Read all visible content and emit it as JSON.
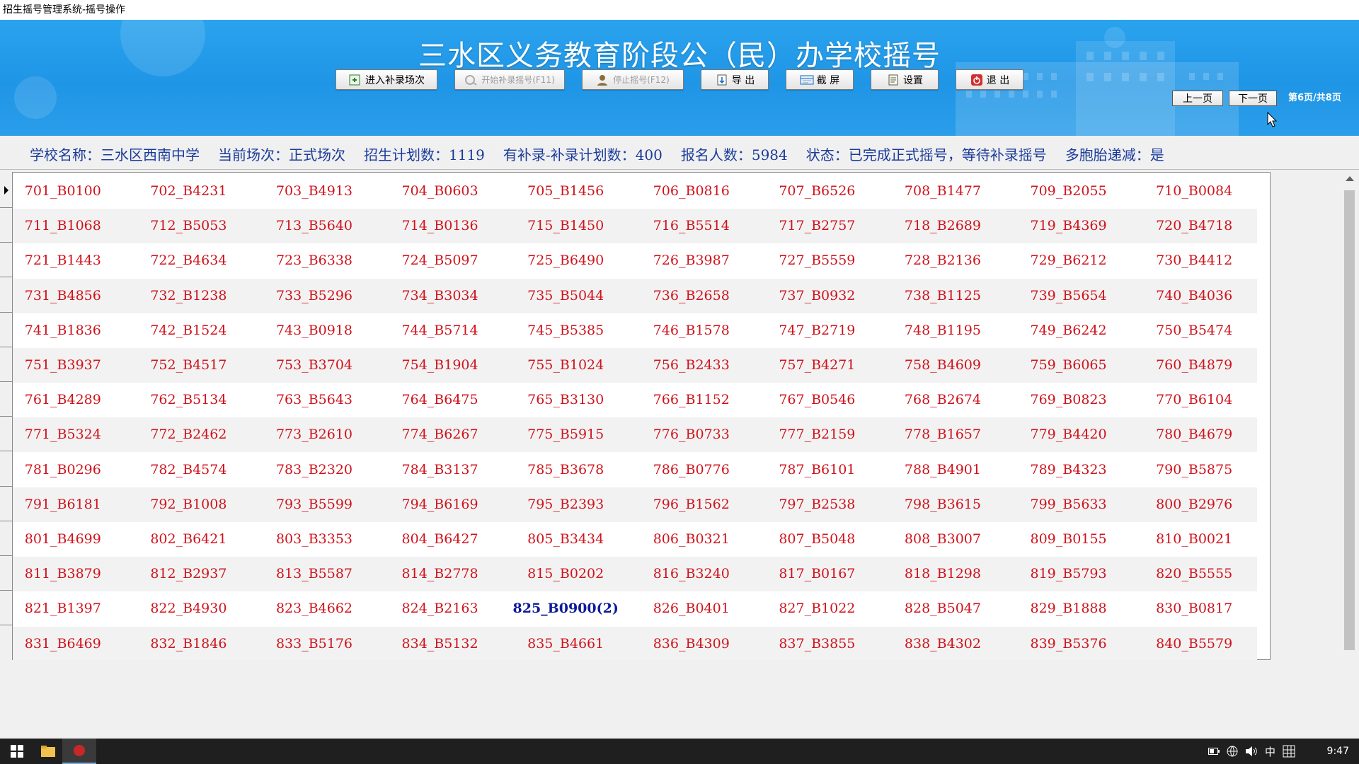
{
  "window": {
    "title": "招生摇号管理系统-摇号操作"
  },
  "banner": {
    "title": "三水区义务教育阶段公（民）办学校摇号"
  },
  "toolbar": {
    "enter_supplement": "进入补录场次",
    "start_supplement": "开始补录摇号(F11)",
    "stop_lottery": "停止摇号(F12)",
    "export": "导 出",
    "screenshot": "截 屏",
    "settings": "设置",
    "exit": "退 出"
  },
  "pager": {
    "prev": "上一页",
    "next": "下一页",
    "page_info": "第6页/共8页"
  },
  "info": {
    "school": "学校名称：三水区西南中学",
    "session": "当前场次：正式场次",
    "plan": "招生计划数：1119",
    "supplement_plan": "有补录-补录计划数：400",
    "applicants": "报名人数：5984",
    "status": "状态：已完成正式摇号，等待补录摇号",
    "multi_birth": "多胞胎递减：是"
  },
  "grid": {
    "rows": [
      [
        "701_B0100",
        "702_B4231",
        "703_B4913",
        "704_B0603",
        "705_B1456",
        "706_B0816",
        "707_B6526",
        "708_B1477",
        "709_B2055",
        "710_B0084"
      ],
      [
        "711_B1068",
        "712_B5053",
        "713_B5640",
        "714_B0136",
        "715_B1450",
        "716_B5514",
        "717_B2757",
        "718_B2689",
        "719_B4369",
        "720_B4718"
      ],
      [
        "721_B1443",
        "722_B4634",
        "723_B6338",
        "724_B5097",
        "725_B6490",
        "726_B3987",
        "727_B5559",
        "728_B2136",
        "729_B6212",
        "730_B4412"
      ],
      [
        "731_B4856",
        "732_B1238",
        "733_B5296",
        "734_B3034",
        "735_B5044",
        "736_B2658",
        "737_B0932",
        "738_B1125",
        "739_B5654",
        "740_B4036"
      ],
      [
        "741_B1836",
        "742_B1524",
        "743_B0918",
        "744_B5714",
        "745_B5385",
        "746_B1578",
        "747_B2719",
        "748_B1195",
        "749_B6242",
        "750_B5474"
      ],
      [
        "751_B3937",
        "752_B4517",
        "753_B3704",
        "754_B1904",
        "755_B1024",
        "756_B2433",
        "757_B4271",
        "758_B4609",
        "759_B6065",
        "760_B4879"
      ],
      [
        "761_B4289",
        "762_B5134",
        "763_B5643",
        "764_B6475",
        "765_B3130",
        "766_B1152",
        "767_B0546",
        "768_B2674",
        "769_B0823",
        "770_B6104"
      ],
      [
        "771_B5324",
        "772_B2462",
        "773_B2610",
        "774_B6267",
        "775_B5915",
        "776_B0733",
        "777_B2159",
        "778_B1657",
        "779_B4420",
        "780_B4679"
      ],
      [
        "781_B0296",
        "782_B4574",
        "783_B2320",
        "784_B3137",
        "785_B3678",
        "786_B0776",
        "787_B6101",
        "788_B4901",
        "789_B4323",
        "790_B5875"
      ],
      [
        "791_B6181",
        "792_B1008",
        "793_B5599",
        "794_B6169",
        "795_B2393",
        "796_B1562",
        "797_B2538",
        "798_B3615",
        "799_B5633",
        "800_B2976"
      ],
      [
        "801_B4699",
        "802_B6421",
        "803_B3353",
        "804_B6427",
        "805_B3434",
        "806_B0321",
        "807_B5048",
        "808_B3007",
        "809_B0155",
        "810_B0021"
      ],
      [
        "811_B3879",
        "812_B2937",
        "813_B5587",
        "814_B2778",
        "815_B0202",
        "816_B3240",
        "817_B0167",
        "818_B1298",
        "819_B5793",
        "820_B5555"
      ],
      [
        "821_B1397",
        "822_B4930",
        "823_B4662",
        "824_B2163",
        "825_B0900(2)",
        "826_B0401",
        "827_B1022",
        "828_B5047",
        "829_B1888",
        "830_B0817"
      ],
      [
        "831_B6469",
        "832_B1846",
        "833_B5176",
        "834_B5132",
        "835_B4661",
        "836_B4309",
        "837_B3855",
        "838_B4302",
        "839_B5376",
        "840_B5579"
      ]
    ],
    "highlight": {
      "row": 12,
      "col": 4,
      "color": "#0d1b9a"
    },
    "entry_color": "#d0121b"
  },
  "taskbar": {
    "clock": "9:47",
    "ime": "中"
  },
  "colors": {
    "banner": "#1f95e6",
    "info_text": "#1a3b9a"
  }
}
